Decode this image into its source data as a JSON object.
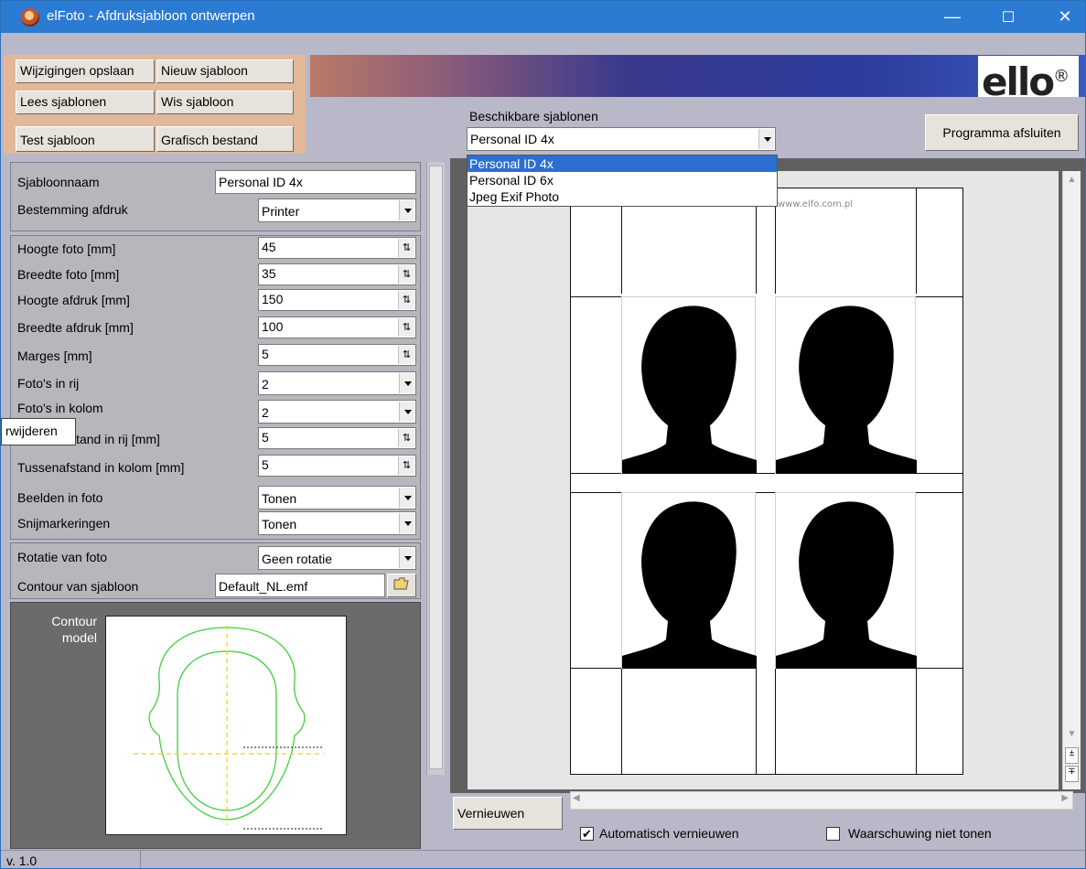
{
  "window": {
    "title": "elFoto - Afdruksjabloon ontwerpen",
    "controls": {
      "minimize": "—",
      "maximize": "☐",
      "close": "✕"
    }
  },
  "toolbar": {
    "save_changes": "Wijzigingen opslaan",
    "new_template": "Nieuw sjabloon",
    "read_templates": "Lees sjablonen",
    "delete_template": "Wis sjabloon",
    "test_template": "Test sjabloon",
    "graphic_file": "Grafisch bestand",
    "exit_program": "Programma afsluiten"
  },
  "logo": {
    "text": "ello",
    "mark": "®"
  },
  "templates": {
    "label": "Beschikbare sjablonen",
    "selected": "Personal ID 4x",
    "options": [
      "Personal ID 4x",
      "Personal ID 6x",
      "Jpeg Exif Photo"
    ]
  },
  "settings": {
    "template_name_label": "Sjabloonnaam",
    "template_name_value": "Personal ID 4x",
    "print_destination_label": "Bestemming afdruk",
    "print_destination_value": "Printer",
    "photo_height_label": "Hoogte foto [mm]",
    "photo_height_value": "45",
    "photo_width_label": "Breedte foto [mm]",
    "photo_width_value": "35",
    "print_height_label": "Hoogte afdruk [mm]",
    "print_height_value": "150",
    "print_width_label": "Breedte afdruk [mm]",
    "print_width_value": "100",
    "margins_label": "Marges [mm]",
    "margins_value": "5",
    "photos_per_row_label": "Foto's in rij",
    "photos_per_row_value": "2",
    "photos_per_column_label": "Foto's in kolom",
    "photos_per_column_value": "2",
    "row_spacing_label": "Tussenafstand in rij [mm]",
    "row_spacing_value": "5",
    "column_spacing_label": "Tussenafstand in kolom [mm]",
    "column_spacing_value": "5",
    "images_in_photo_label": "Beelden in foto",
    "images_in_photo_value": "Tonen",
    "cut_marks_label": "Snijmarkeringen",
    "cut_marks_value": "Tonen",
    "rotation_label": "Rotatie van foto",
    "rotation_value": "Geen rotatie",
    "template_contour_label": "Contour van sjabloon",
    "template_contour_value": "Default_NL.emf"
  },
  "tooltip": {
    "text": "rwijderen"
  },
  "contour_model": {
    "label_line1": "Contour",
    "label_line2": "model"
  },
  "preview": {
    "watermark": "www.elfo.com.pl",
    "refresh_button": "Vernieuwen",
    "auto_refresh_label": "Automatisch vernieuwen",
    "auto_refresh_checked": true,
    "no_warning_label": "Waarschuwing niet tonen",
    "no_warning_checked": false
  },
  "status": {
    "version": "v. 1.0"
  },
  "colors": {
    "titlebar": "#2b7bd3",
    "panel": "#b6b6bd",
    "selection": "#2d6fd0",
    "contour_line": "#3fcf3f",
    "contour_axis": "#e6d020"
  }
}
